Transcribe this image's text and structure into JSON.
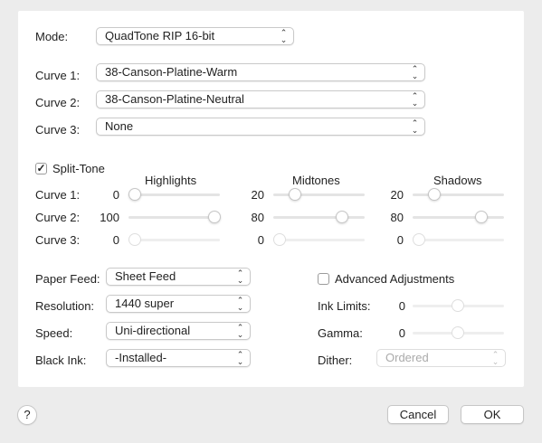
{
  "mode": {
    "label": "Mode:",
    "value": "QuadTone RIP 16-bit"
  },
  "curves": [
    {
      "label": "Curve 1:",
      "value": "38-Canson-Platine-Warm"
    },
    {
      "label": "Curve 2:",
      "value": "38-Canson-Platine-Neutral"
    },
    {
      "label": "Curve 3:",
      "value": "None"
    }
  ],
  "split_tone": {
    "label": "Split-Tone",
    "checked": true,
    "columns": {
      "highlights": "Highlights",
      "midtones": "Midtones",
      "shadows": "Shadows"
    },
    "rows": [
      {
        "label": "Curve 1:",
        "highlights": "0",
        "midtones": "20",
        "shadows": "20"
      },
      {
        "label": "Curve 2:",
        "highlights": "100",
        "midtones": "80",
        "shadows": "80"
      },
      {
        "label": "Curve 3:",
        "highlights": "0",
        "midtones": "0",
        "shadows": "0"
      }
    ]
  },
  "settings": {
    "paper_feed": {
      "label": "Paper Feed:",
      "value": "Sheet Feed"
    },
    "resolution": {
      "label": "Resolution:",
      "value": "1440 super"
    },
    "speed": {
      "label": "Speed:",
      "value": "Uni-directional"
    },
    "black_ink": {
      "label": "Black Ink:",
      "value": "-Installed-"
    }
  },
  "advanced": {
    "label": "Advanced Adjustments",
    "checked": false,
    "ink_limits": {
      "label": "Ink Limits:",
      "value": "0"
    },
    "gamma": {
      "label": "Gamma:",
      "value": "0"
    },
    "dither": {
      "label": "Dither:",
      "value": "Ordered"
    }
  },
  "footer": {
    "help": "?",
    "cancel": "Cancel",
    "ok": "OK"
  },
  "icons": {
    "popup_chevron": "up-down-chevron",
    "checkmark": "checkmark"
  }
}
